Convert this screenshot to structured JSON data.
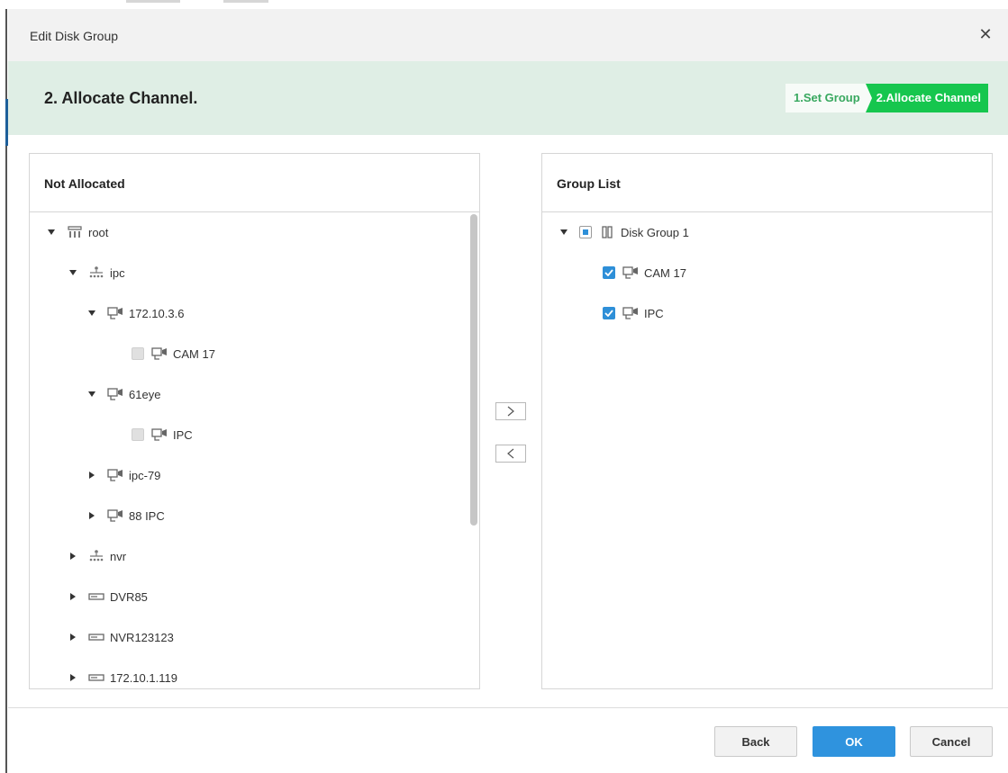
{
  "dialog": {
    "title": "Edit Disk Group",
    "close_icon": "close-icon",
    "heading": "2.  Allocate Channel.",
    "steps": [
      {
        "label": "1.Set Group",
        "active": false
      },
      {
        "label": "2.Allocate Channel",
        "active": true
      }
    ]
  },
  "left_panel": {
    "header": "Not Allocated",
    "tree": [
      {
        "label": "root",
        "icon": "root-server-icon",
        "expanded": true
      },
      {
        "label": "ipc",
        "icon": "network-group-icon",
        "expanded": true
      },
      {
        "label": "172.10.3.6",
        "icon": "camera-icon",
        "expanded": true
      },
      {
        "label": "CAM 17",
        "icon": "camera-icon",
        "checked": false
      },
      {
        "label": "61eye",
        "icon": "camera-icon",
        "expanded": true
      },
      {
        "label": "IPC",
        "icon": "camera-icon",
        "checked": false
      },
      {
        "label": "ipc-79",
        "icon": "camera-icon",
        "expanded": false
      },
      {
        "label": "88 IPC",
        "icon": "camera-icon",
        "expanded": false
      },
      {
        "label": "nvr",
        "icon": "network-group-icon",
        "expanded": false
      },
      {
        "label": "DVR85",
        "icon": "recorder-icon",
        "expanded": false
      },
      {
        "label": "NVR123123",
        "icon": "recorder-icon",
        "expanded": false
      },
      {
        "label": "172.10.1.119",
        "icon": "recorder-icon",
        "expanded": false
      }
    ]
  },
  "right_panel": {
    "header": "Group List",
    "tree": [
      {
        "label": "Disk Group 1",
        "icon": "disk-group-icon",
        "expanded": true,
        "checked": "partial"
      },
      {
        "label": "CAM 17",
        "icon": "camera-icon",
        "checked": true
      },
      {
        "label": "IPC",
        "icon": "camera-icon",
        "checked": true
      }
    ]
  },
  "transfer": {
    "move_right_icon": "chevron-right-icon",
    "move_left_icon": "chevron-left-icon"
  },
  "buttons": {
    "back": "Back",
    "ok": "OK",
    "cancel": "Cancel"
  },
  "colors": {
    "step_active": "#16c64e",
    "step_bar_bg": "#dfeee5",
    "checkbox_checked": "#2e8fd8",
    "ok_button": "#2f93de"
  }
}
